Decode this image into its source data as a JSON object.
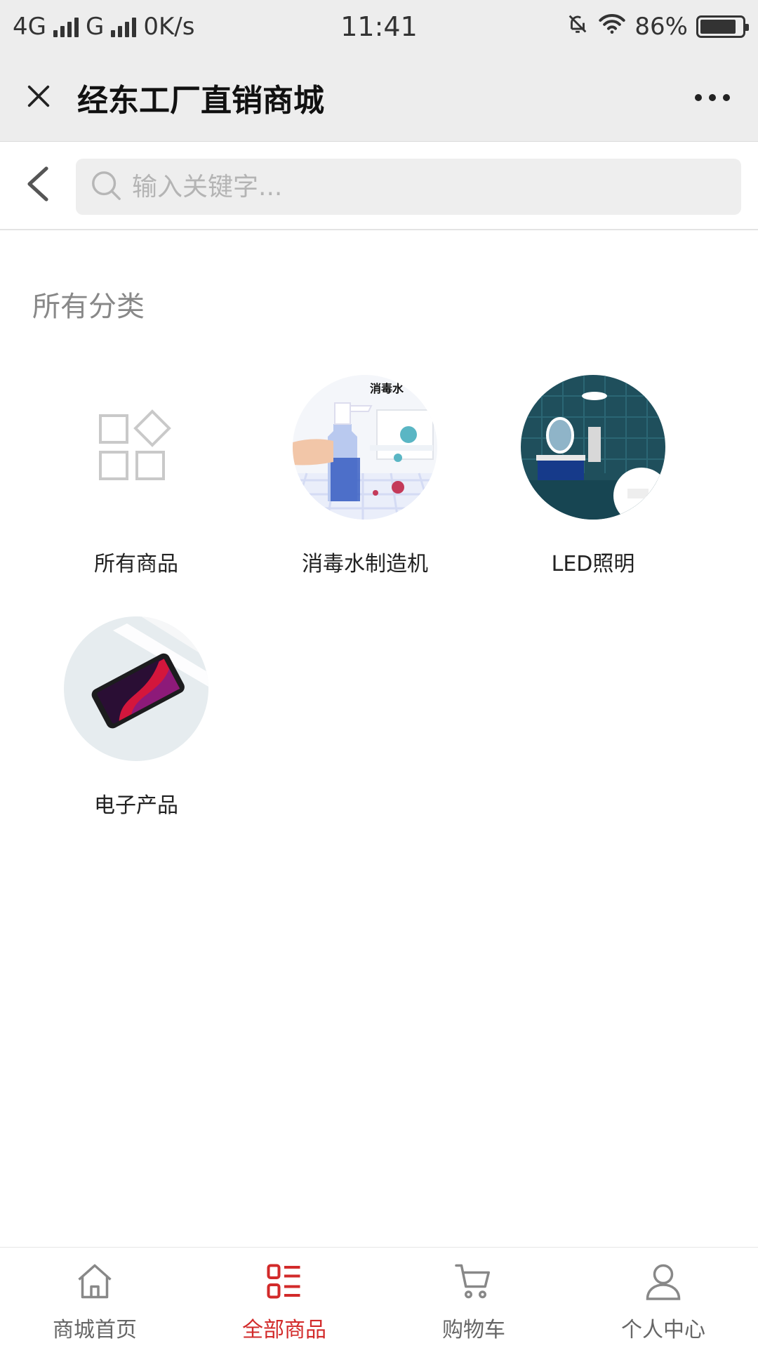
{
  "status_bar": {
    "network1": "4G",
    "network2": "G",
    "speed": "0K/s",
    "time": "11:41",
    "battery": "86%",
    "battery_level": 0.86
  },
  "title_bar": {
    "title": "经东工厂直销商城"
  },
  "search": {
    "placeholder": "输入关键字..."
  },
  "section": {
    "title": "所有分类"
  },
  "categories": [
    {
      "label": "所有商品",
      "icon": "grid-icon"
    },
    {
      "label": "消毒水制造机",
      "icon": "spray-bottle-image",
      "image_text": "消毒水"
    },
    {
      "label": "LED照明",
      "icon": "bathroom-image"
    },
    {
      "label": "电子产品",
      "icon": "smartphone-image"
    }
  ],
  "tabs": [
    {
      "label": "商城首页",
      "icon": "home-icon",
      "active": false
    },
    {
      "label": "全部商品",
      "icon": "category-list-icon",
      "active": true
    },
    {
      "label": "购物车",
      "icon": "cart-icon",
      "active": false
    },
    {
      "label": "个人中心",
      "icon": "user-icon",
      "active": false
    }
  ],
  "colors": {
    "accent": "#d22a2a",
    "header_bg": "#ededed",
    "search_bg": "#eeeeee"
  }
}
